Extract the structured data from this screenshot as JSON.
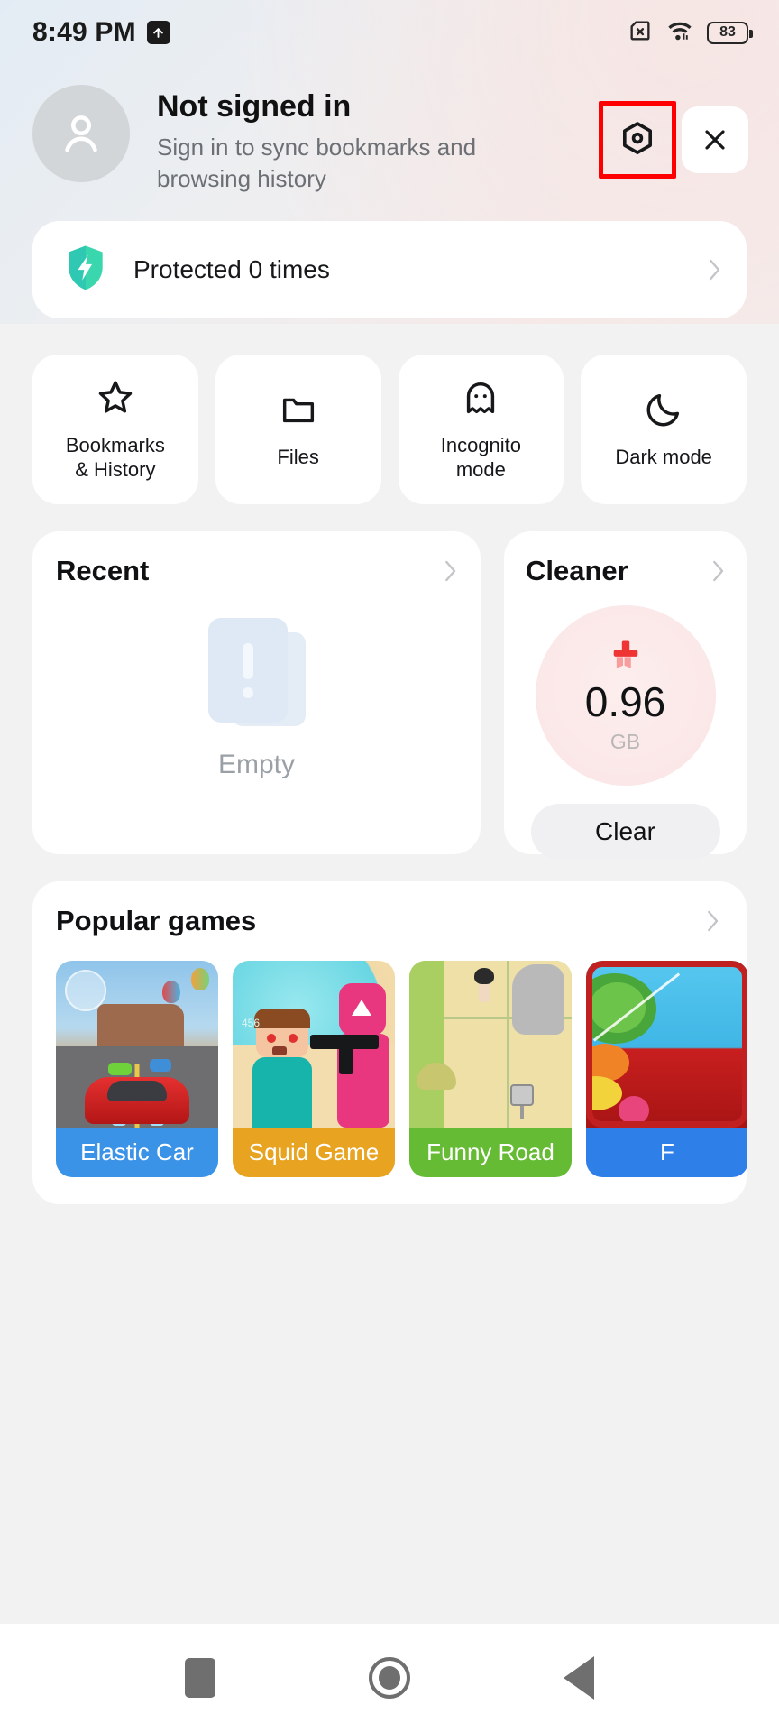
{
  "status_bar": {
    "time": "8:49 PM",
    "upload_icon": "upload-arrow-icon",
    "sim_icon": "sim-card-off-icon",
    "wifi_icon": "wifi-icon",
    "battery_level": "83"
  },
  "account": {
    "avatar_icon": "user-avatar-icon",
    "title": "Not signed in",
    "subtitle": "Sign in to sync bookmarks and browsing history",
    "settings_icon": "settings-hexagon-icon",
    "close_icon": "close-icon",
    "highlight_color": "#ff0000"
  },
  "protection": {
    "shield_icon": "shield-bolt-icon",
    "label": "Protected 0 times",
    "chevron_icon": "chevron-right-icon",
    "accent_color": "#3ad6ad"
  },
  "quick_actions": [
    {
      "icon": "star-icon",
      "label": "Bookmarks\n& History"
    },
    {
      "icon": "folder-icon",
      "label": "Files"
    },
    {
      "icon": "ghost-icon",
      "label": "Incognito\nmode"
    },
    {
      "icon": "moon-icon",
      "label": "Dark mode"
    }
  ],
  "recent": {
    "title": "Recent",
    "chevron_icon": "chevron-right-icon",
    "empty_icon": "empty-document-icon",
    "empty_label": "Empty"
  },
  "cleaner": {
    "title": "Cleaner",
    "chevron_icon": "chevron-right-icon",
    "brush_icon": "cleaner-brush-icon",
    "value": "0.96",
    "unit": "GB",
    "button_label": "Clear",
    "accent_color": "#ef3434"
  },
  "popular_games": {
    "title": "Popular games",
    "chevron_icon": "chevron-right-icon",
    "items": [
      {
        "name": "Elastic Car",
        "bar_color": "#3b93e8"
      },
      {
        "name": "Squid Game",
        "bar_color": "#e8a321"
      },
      {
        "name": "Funny Road",
        "bar_color": "#66bb34"
      },
      {
        "name": "F",
        "bar_color": "#2f7fe8"
      }
    ]
  },
  "nav_bar": {
    "recents_icon": "recents-square-icon",
    "home_icon": "home-circle-icon",
    "back_icon": "back-triangle-icon"
  }
}
